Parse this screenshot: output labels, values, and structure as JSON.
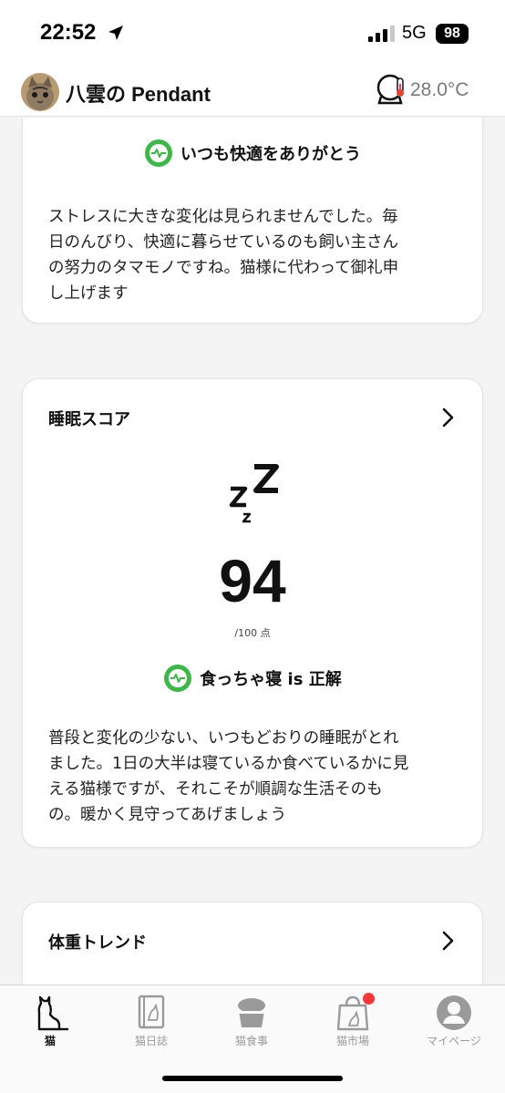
{
  "status_bar": {
    "time": "22:52",
    "network": "5G",
    "battery": "98"
  },
  "header": {
    "title": "八雲の Pendant",
    "temperature": "28.0°C"
  },
  "comfort_card": {
    "badge": "いつも快適をありがとう",
    "body": "ストレスに大きな変化は見られませんでした。毎\n日のんびり、快適に暮らせているのも飼い主さん\nの努力のタマモノですね。猫様に代わって御礼申\nし上げます"
  },
  "sleep_card": {
    "title": "睡眠スコア",
    "score": "94",
    "score_unit": "/100 点",
    "badge": "食っちゃ寝 is 正解",
    "body": "普段と変化の少ない、いつもどおりの睡眠がとれ\nました。1日の大半は寝ているか食べているかに見\nえる猫様ですが、それこそが順調な生活そのも\nの。暖かく見守ってあげましょう"
  },
  "weight_card": {
    "title": "体重トレンド"
  },
  "tabs": [
    {
      "label": "猫",
      "icon": "cat-icon",
      "active": true
    },
    {
      "label": "猫日誌",
      "icon": "diary-icon",
      "active": false
    },
    {
      "label": "猫食事",
      "icon": "food-bowl-icon",
      "active": false
    },
    {
      "label": "猫市場",
      "icon": "shopping-bag-icon",
      "active": false
    },
    {
      "label": "マイページ",
      "icon": "user-icon",
      "active": false
    }
  ],
  "colors": {
    "accent_green": "#3fb54a",
    "notification_red": "#f23a3a",
    "muted_gray": "#9a9a9a"
  }
}
